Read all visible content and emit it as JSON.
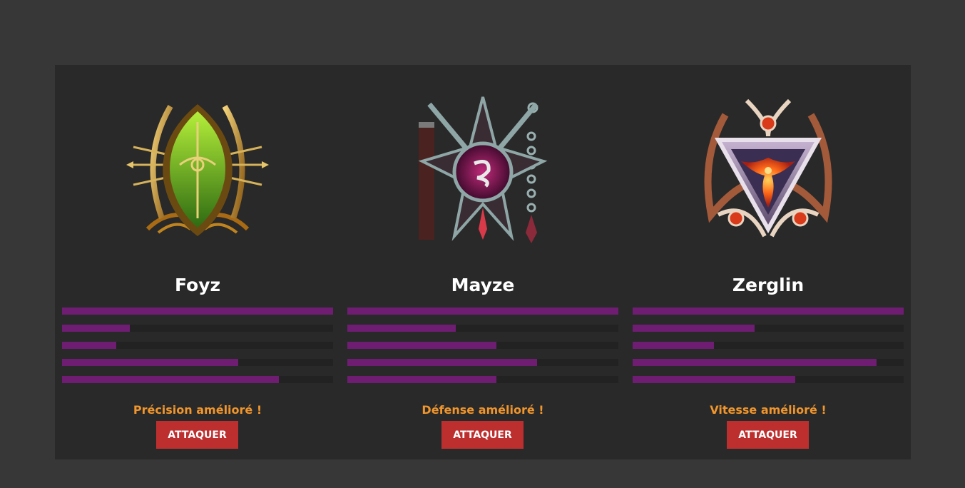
{
  "colors": {
    "page_bg": "#373737",
    "panel_bg": "#292929",
    "bar_track": "#222222",
    "bar_fill": "#6f1c73",
    "bonus_text": "#f0962c",
    "button_bg": "#bd2f2f"
  },
  "characters": [
    {
      "name": "Foyz",
      "emblem": "elf-archer-emblem-icon",
      "stats": [
        1.0,
        0.25,
        0.2,
        0.65,
        0.8
      ],
      "bonus": "Précision amélioré !",
      "button_label": "ATTAQUER"
    },
    {
      "name": "Mayze",
      "emblem": "dark-flail-emblem-icon",
      "stats": [
        1.0,
        0.4,
        0.55,
        0.7,
        0.55
      ],
      "bonus": "Défense amélioré !",
      "button_label": "ATTAQUER"
    },
    {
      "name": "Zerglin",
      "emblem": "phoenix-emblem-icon",
      "stats": [
        1.0,
        0.45,
        0.3,
        0.9,
        0.6
      ],
      "bonus": "Vitesse amélioré !",
      "button_label": "ATTAQUER"
    }
  ]
}
